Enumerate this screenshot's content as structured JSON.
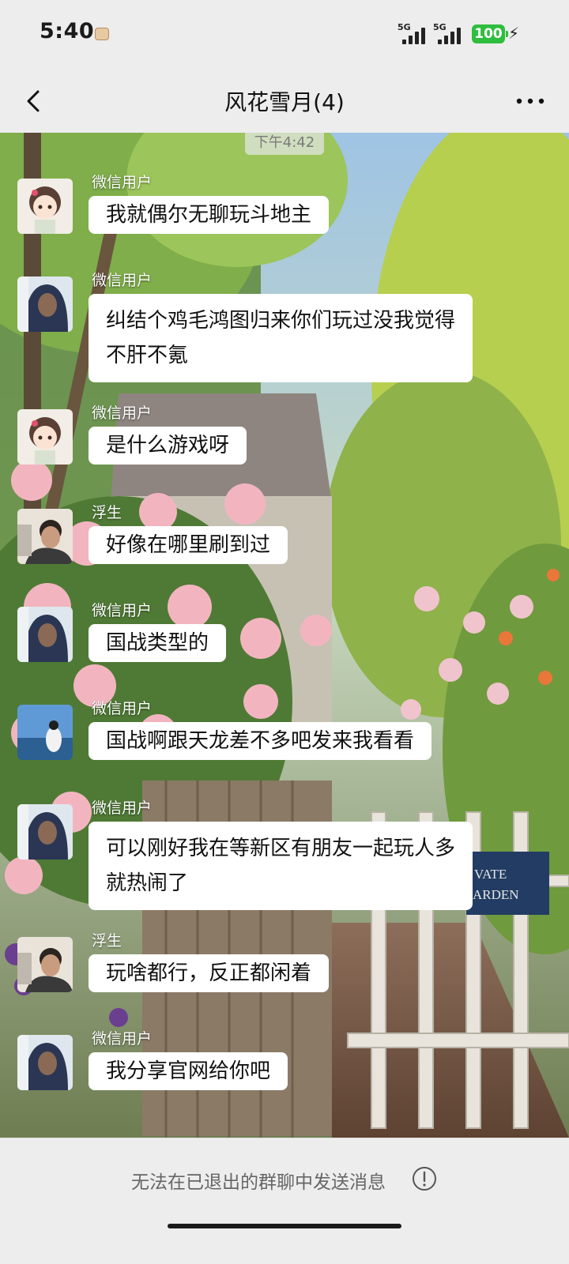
{
  "status_bar": {
    "time": "5:40",
    "signal_1": "5G",
    "signal_2": "5G",
    "battery": "100",
    "battery_color": "#2fbd3e"
  },
  "header": {
    "title": "风花雪月(4)",
    "back_icon": "chevron-left-icon",
    "more_icon": "more-icon"
  },
  "chat": {
    "timestamp": "下午4:42",
    "messages": [
      {
        "sender": "微信用户",
        "text": "我就偶尔无聊玩斗地主",
        "avatar": "anime-girl-avatar"
      },
      {
        "sender": "微信用户",
        "text": "纠结个鸡毛鸿图归来你们玩过没我觉得不肝不氪",
        "avatar": "hoodie-avatar"
      },
      {
        "sender": "微信用户",
        "text": "是什么游戏呀",
        "avatar": "anime-girl-avatar"
      },
      {
        "sender": "浮生",
        "text": "好像在哪里刷到过",
        "avatar": "man-avatar"
      },
      {
        "sender": "微信用户",
        "text": "国战类型的",
        "avatar": "hoodie-avatar"
      },
      {
        "sender": "微信用户",
        "text": "国战啊跟天龙差不多吧发来我看看",
        "avatar": "sea-avatar"
      },
      {
        "sender": "微信用户",
        "text": "可以刚好我在等新区有朋友一起玩人多就热闹了",
        "avatar": "hoodie-avatar"
      },
      {
        "sender": "浮生",
        "text": "玩啥都行，反正都闲着",
        "avatar": "man-avatar"
      },
      {
        "sender": "微信用户",
        "text": "我分享官网给你吧",
        "avatar": "hoodie-avatar"
      }
    ]
  },
  "footer": {
    "notice": "无法在已退出的群聊中发送消息",
    "notice_icon": "exclamation-circle-icon"
  }
}
